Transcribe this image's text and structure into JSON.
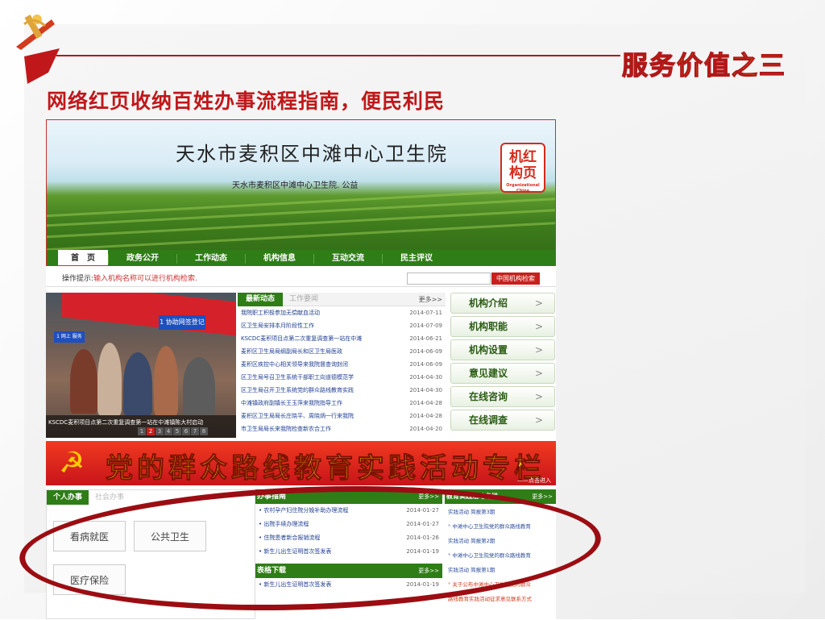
{
  "slide": {
    "tag": "服务价值之三",
    "title": "网络红页收纳百姓办事流程指南，便民利民"
  },
  "site": {
    "title": "天水市麦积区中滩中心卫生院",
    "subtitle": "天水市麦积区中滩中心卫生院. 公益",
    "seal_text": [
      "机红",
      "构页"
    ],
    "seal_small": "Organizational China",
    "nav": [
      "首　页",
      "政务公开",
      "工作动态",
      "机构信息",
      "互动交流",
      "民主评议"
    ],
    "hint_label": "操作提示:",
    "hint_text": "输入机构名称可以进行机构检索.",
    "search_button": "中国机构检索",
    "photo_signs": [
      "1 协助网签登记",
      "1 网上 服务"
    ],
    "photo_caption": "KSCDC麦积项目点第二次重复调查第一站在中滩镇陈大村启动",
    "pager": [
      "1",
      "2",
      "3",
      "4",
      "5",
      "6",
      "7",
      "8"
    ],
    "news": {
      "tab_active": "最新动态",
      "tab_inactive": "工作要闻",
      "more": "更多>>",
      "items": [
        {
          "title": "我院职工积极参加无偿献血活动",
          "date": "2014-07-11"
        },
        {
          "title": "区卫生局安排本月阶段性工作",
          "date": "2014-07-09"
        },
        {
          "title": "KSCDC麦积项目点第二次重复调查第一站在中滩",
          "date": "2014-06-21"
        },
        {
          "title": "麦积区卫生局局纲副局长和区卫生局医政",
          "date": "2014-06-09"
        },
        {
          "title": "麦积区疾控中心相关领导来我院督查询封闭",
          "date": "2014-06-09"
        },
        {
          "title": "区卫生局号召卫生系统干部职工向道德模范学",
          "date": "2014-04-30"
        },
        {
          "title": "区卫生局召开卫生系统党的群众路线教育实践",
          "date": "2014-04-30"
        },
        {
          "title": "中滩镇政府副镇长王玉萍来我院指导工作",
          "date": "2014-04-28"
        },
        {
          "title": "麦积区卫生局局长庄晓平、周晓炳一行来我院",
          "date": "2014-04-28"
        },
        {
          "title": "市卫生局局长来我院检查新农合工作",
          "date": "2014-04-20"
        }
      ]
    },
    "side_buttons": [
      "机构介绍",
      "机构职能",
      "机构设置",
      "意见建议",
      "在线咨询",
      "在线调查"
    ],
    "side_chevron": ">",
    "party_banner": "党的群众路线教育实践活动专栏",
    "party_click": "——点击进入",
    "personal": {
      "tab_active": "个人办事",
      "tab_inactive": "社会办事",
      "buttons": [
        "看病就医",
        "公共卫生",
        "医疗保险"
      ]
    },
    "guide": {
      "title": "办事指南",
      "more": "更多>>",
      "items": [
        {
          "title": "• 农村孕产妇住院分娩补助办理流程",
          "date": "2014-01-27"
        },
        {
          "title": "• 出院手续办理流程",
          "date": "2014-01-27"
        },
        {
          "title": "• 住院患者新合报销流程",
          "date": "2014-01-26"
        },
        {
          "title": "• 新生儿出生证明首次签发表",
          "date": "2014-01-19"
        }
      ]
    },
    "forms": {
      "title": "表格下载",
      "more": "更多>>",
      "items": [
        {
          "title": "• 新生儿出生证明首次签发表",
          "date": "2014-01-19"
        }
      ]
    },
    "edu": {
      "title": "教育实践活动专栏",
      "more": "更多>>",
      "items": [
        {
          "text": "实践活动 简报第3期",
          "red": false
        },
        {
          "text": "° 中滩中心卫生院党的群众路线教育",
          "red": false
        },
        {
          "text": "实践活动 简报第2期",
          "red": false
        },
        {
          "text": "° 中滩中心卫生院党的群众路线教育",
          "red": false
        },
        {
          "text": "实践活动 简报第1期",
          "red": false
        },
        {
          "text": "° 关于公布中滩中心卫生院党的群众",
          "red": true
        },
        {
          "text": "路线教育实践活动征求意见联系方式",
          "red": true
        }
      ]
    }
  },
  "colors": {
    "accent_red": "#c0181a",
    "site_green": "#2e7d16",
    "tag_orange": "#f5a623",
    "oval": "#9b0d12"
  }
}
